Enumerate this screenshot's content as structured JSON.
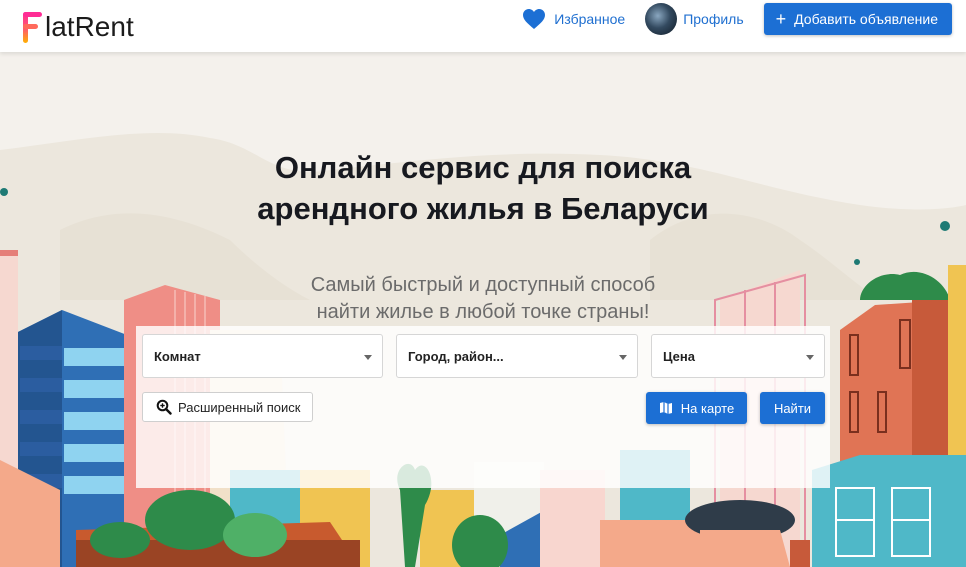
{
  "header": {
    "logo_letter": "F",
    "logo_text": "latRent",
    "favorites_label": "Избранное",
    "profile_label": "Профиль",
    "add_button_label": "Добавить объявление"
  },
  "hero": {
    "title_line1": "Онлайн сервис для поиска",
    "title_line2": "арендного жилья в Беларуси",
    "subtitle_line1": "Самый быстрый и доступный способ",
    "subtitle_line2": "найти жилье в любой точке страны!"
  },
  "search": {
    "rooms_value": "Комнат",
    "city_value": "Город, район...",
    "price_value": "Цена",
    "advanced_label": "Расширенный поиск",
    "map_label": "На карте",
    "find_label": "Найти"
  },
  "colors": {
    "primary": "#1c6fd4",
    "link": "#1f6fd0",
    "heart": "#1c6fd4",
    "logo_gradient": [
      "#ff2d95",
      "#ffb100"
    ]
  },
  "icons": {
    "favorites": "heart-icon",
    "add": "plus-icon",
    "advanced": "search-icon",
    "map": "map-icon",
    "select": "chevron-down-icon"
  }
}
